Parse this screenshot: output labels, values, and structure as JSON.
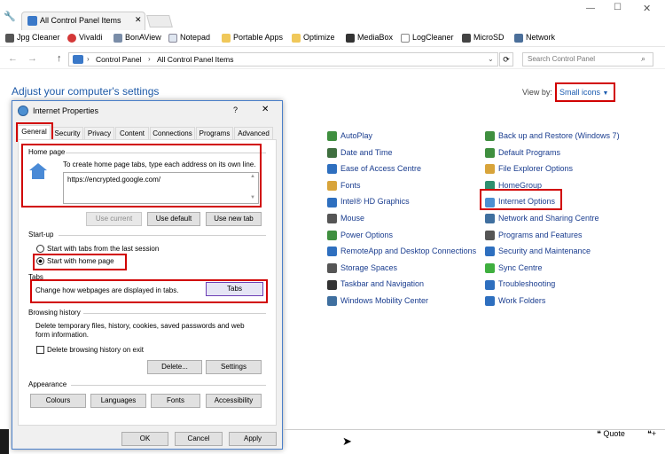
{
  "browser": {
    "tab_title": "All Control Panel Items",
    "bookmarks": [
      "Jpg Cleaner",
      "Vivaldi",
      "BonAView",
      "Notepad",
      "Portable Apps",
      "Optimize",
      "MediaBox",
      "LogCleaner",
      "MicroSD",
      "Network"
    ],
    "address": [
      "Control Panel",
      "All Control Panel Items"
    ],
    "search_placeholder": "Search Control Panel"
  },
  "header": {
    "title": "Adjust your computer's settings",
    "view_by_label": "View by:",
    "view_by_value": "Small icons"
  },
  "col3": [
    "AutoPlay",
    "Date and Time",
    "Ease of Access Centre",
    "Fonts",
    "Intel® HD Graphics",
    "Mouse",
    "Power Options",
    "RemoteApp and Desktop Connections",
    "Storage Spaces",
    "Taskbar and Navigation",
    "Windows Mobility Center"
  ],
  "col4": [
    "Back up and Restore (Windows 7)",
    "Default Programs",
    "File Explorer Options",
    "HomeGroup",
    "Internet Options",
    "Network and Sharing Centre",
    "Programs and Features",
    "Security and Maintenance",
    "Sync Centre",
    "Troubleshooting",
    "Work Folders"
  ],
  "dialog": {
    "title": "Internet Properties",
    "help": "?",
    "close": "✕",
    "tabs": [
      "General",
      "Security",
      "Privacy",
      "Content",
      "Connections",
      "Programs",
      "Advanced"
    ],
    "home_page": {
      "label": "Home page",
      "desc": "To create home page tabs, type each address on its own line.",
      "url": "https://encrypted.google.com/",
      "use_current": "Use current",
      "use_default": "Use default",
      "use_new_tab": "Use new tab"
    },
    "startup": {
      "label": "Start-up",
      "opt1": "Start with tabs from the last session",
      "opt2": "Start with home page"
    },
    "tabs_sect": {
      "label": "Tabs",
      "desc": "Change how webpages are displayed in tabs.",
      "button": "Tabs"
    },
    "history": {
      "label": "Browsing history",
      "desc": "Delete temporary files, history, cookies, saved passwords and web form information.",
      "checkbox": "Delete browsing history on exit",
      "delete": "Delete...",
      "settings": "Settings"
    },
    "appearance": {
      "label": "Appearance",
      "colours": "Colours",
      "languages": "Languages",
      "fonts": "Fonts",
      "accessibility": "Accessibility"
    },
    "ok": "OK",
    "cancel": "Cancel",
    "apply": "Apply"
  },
  "footer": {
    "quote": "Quote"
  },
  "colors": {
    "link": "#1a3d8f",
    "title": "#1e5aa8",
    "highlight": "#d10000"
  }
}
